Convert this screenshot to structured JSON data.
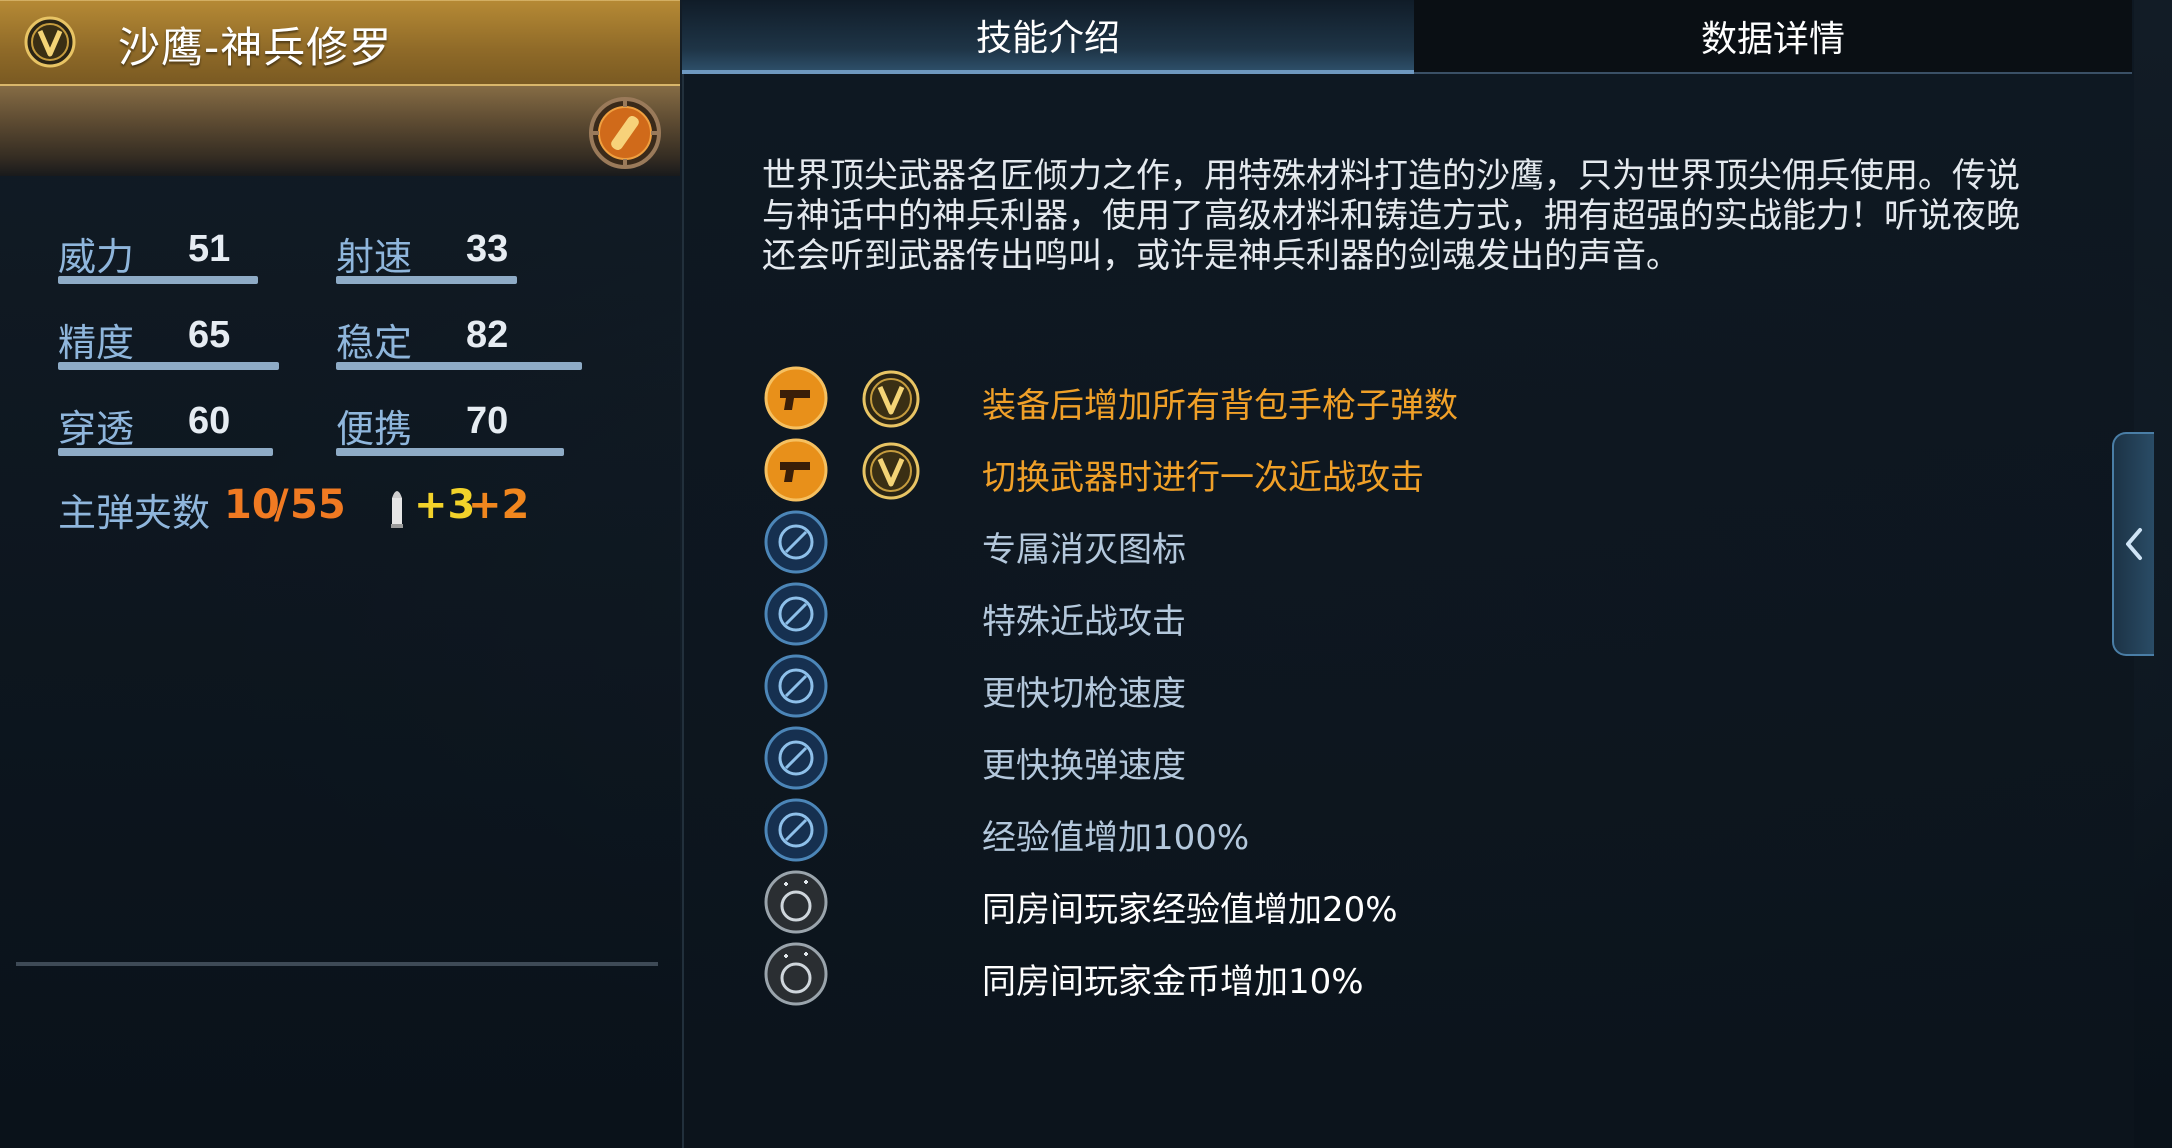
{
  "weapon": {
    "name": "沙鹰-神兵修罗",
    "rank_badge": "V"
  },
  "stats": [
    {
      "label": "威力",
      "value": "51",
      "fill": 0.51
    },
    {
      "label": "射速",
      "value": "33",
      "fill": 0.33
    },
    {
      "label": "精度",
      "value": "65",
      "fill": 0.65
    },
    {
      "label": "稳定",
      "value": "82",
      "fill": 0.82
    },
    {
      "label": "穿透",
      "value": "60",
      "fill": 0.6
    },
    {
      "label": "便携",
      "value": "70",
      "fill": 0.7
    }
  ],
  "magazine": {
    "label": "主弹夹数",
    "current": "10",
    "separator": "/",
    "total": "55",
    "bonus_a": "+3",
    "bonus_b": "+2"
  },
  "tabs": {
    "skills": "技能介绍",
    "details": "数据详情"
  },
  "description": "世界顶尖武器名匠倾力之作，用特殊材料打造的沙鹰，只为世界顶尖佣兵使用。传说与神话中的神兵利器，使用了高级材料和铸造方式，拥有超强的实战能力！听说夜晚还会听到武器传出鸣叫，或许是神兵利器的剑魂发出的声音。",
  "skills": [
    {
      "text": "装备后增加所有背包手枪子弹数",
      "icon": "pistol-ammo-icon",
      "v_badge": true,
      "color": "#f0a028"
    },
    {
      "text": "切换武器时进行一次近战攻击",
      "icon": "pistol-melee-icon",
      "v_badge": true,
      "color": "#f0a028"
    },
    {
      "text": "专属消灭图标",
      "icon": "kill-mark-icon",
      "v_badge": false,
      "color": "#b4c8dc"
    },
    {
      "text": "特殊近战攻击",
      "icon": "melee-attack-icon",
      "v_badge": false,
      "color": "#b4c8dc"
    },
    {
      "text": "更快切枪速度",
      "icon": "fast-switch-icon",
      "v_badge": false,
      "color": "#b4c8dc"
    },
    {
      "text": "更快换弹速度",
      "icon": "fast-reload-icon",
      "v_badge": false,
      "color": "#b4c8dc"
    },
    {
      "text": "经验值增加100%",
      "icon": "exp-boost-icon",
      "v_badge": false,
      "color": "#b4c8dc"
    },
    {
      "text": "同房间玩家经验值增加20%",
      "icon": "room-exp-boost-icon",
      "v_badge": false,
      "color": "#ffffff"
    },
    {
      "text": "同房间玩家金币增加10%",
      "icon": "room-gold-boost-icon",
      "v_badge": false,
      "color": "#ffffff"
    }
  ],
  "colors": {
    "accent_gold": "#f0a028",
    "skill_blue": "#b4c8dc",
    "stat_label": "#8fb6dc",
    "magazine_orange": "#f07a22",
    "bonus_yellow": "#f2d22a"
  }
}
